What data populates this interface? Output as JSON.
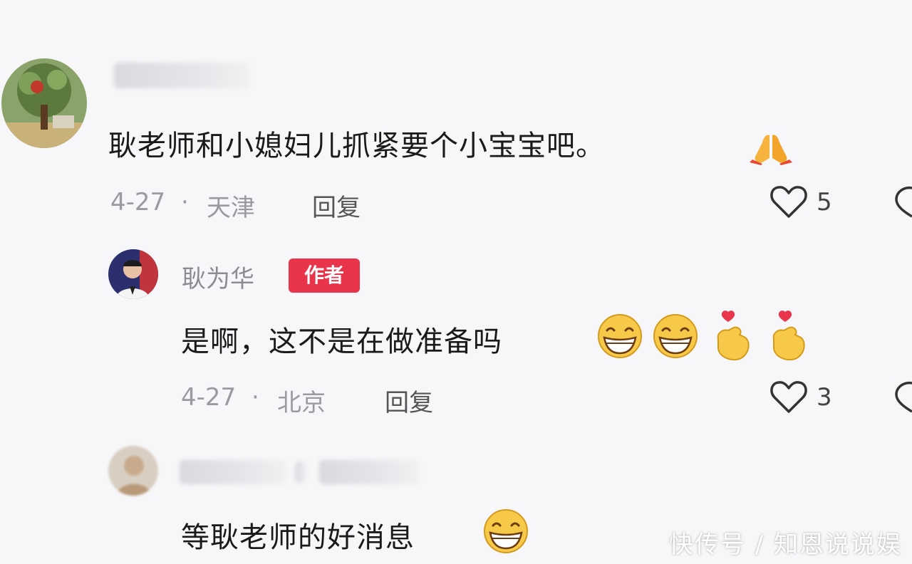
{
  "comments": [
    {
      "text": "耿老师和小媳妇儿抓紧要个小宝宝吧。",
      "date": "4-27",
      "location": "天津",
      "reply_label": "回复",
      "likes": "5",
      "emoji": [
        "praying-hands"
      ]
    },
    {
      "author": "耿为华",
      "badge": "作者",
      "text": "是啊，这不是在做准备吗",
      "date": "4-27",
      "location": "北京",
      "reply_label": "回复",
      "likes": "3",
      "emoji": [
        "grin-face",
        "grin-face",
        "finger-heart",
        "finger-heart"
      ]
    },
    {
      "text": "等耿老师的好消息",
      "emoji": [
        "grin-face"
      ]
    }
  ],
  "watermark": "快传号 / 知恩说说娱"
}
